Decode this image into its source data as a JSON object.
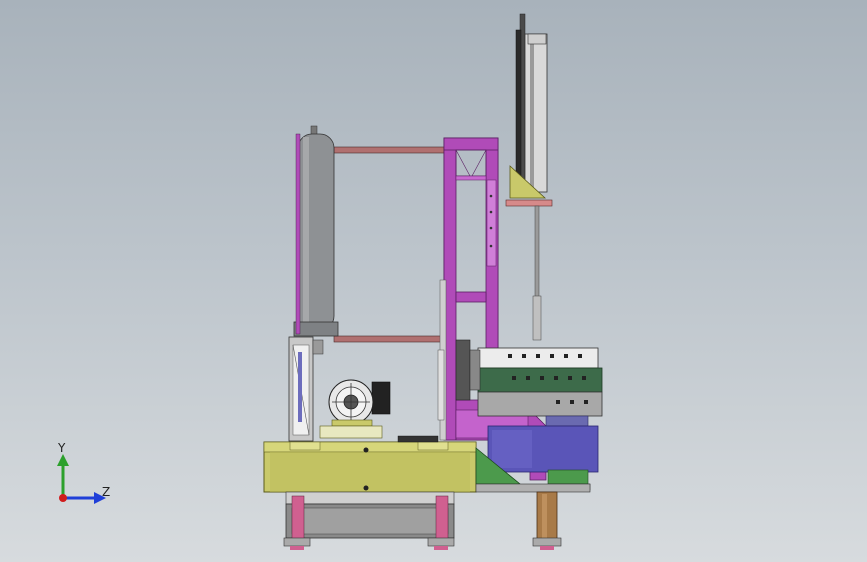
{
  "viewport": {
    "background_top": "#a8b2bb",
    "background_bottom": "#d7dbde"
  },
  "axes": {
    "y_label": "Y",
    "z_label": "Z",
    "y_color": "#2ca02c",
    "z_color": "#1f3fd8",
    "origin_color": "#d01c1c"
  },
  "parts": [
    "gas-tank",
    "purple-frame",
    "vertical-cylinder",
    "rotary-drum",
    "motor",
    "olive-base",
    "support-legs",
    "output-shaft"
  ],
  "colors": {
    "frame": "#b04bb8",
    "frame_dark": "#7a2a86",
    "tank": "#8e9194",
    "base": "#c9c96a",
    "base_dark": "#7f7f2a",
    "drum_green": "#3d6b4a",
    "drum_blue": "#5a55b8",
    "support_green": "#4c9a4c",
    "shaft": "#a87a48",
    "rail": "#b07070"
  }
}
